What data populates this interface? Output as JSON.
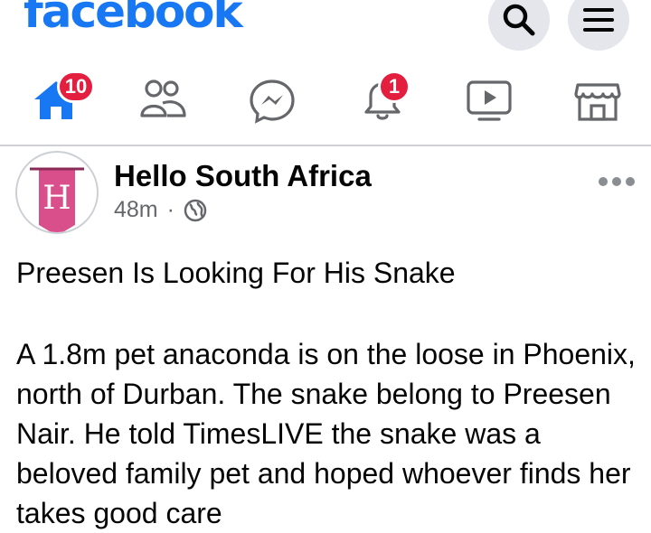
{
  "header": {
    "logo_text": "facebook",
    "brand_color": "#1877f2",
    "search_icon": "search-icon",
    "menu_icon": "menu-icon"
  },
  "nav": {
    "items": [
      {
        "icon": "home-icon",
        "badge": "10",
        "active": true
      },
      {
        "icon": "friends-icon",
        "badge": ""
      },
      {
        "icon": "messenger-icon",
        "badge": ""
      },
      {
        "icon": "bell-icon",
        "badge": "1"
      },
      {
        "icon": "watch-icon",
        "badge": ""
      },
      {
        "icon": "marketplace-icon",
        "badge": ""
      }
    ],
    "badge_color": "#e41e3f"
  },
  "post": {
    "page_name": "Hello South Africa",
    "avatar_letter": "H",
    "time": "48m",
    "separator": "·",
    "audience_icon": "globe-icon",
    "title": "Preesen Is Looking For His Snake",
    "body": "A 1.8m pet anaconda is on the loose in Phoenix, north of Durban. The snake belong to Preesen Nair. He told TimesLIVE the snake was a beloved family pet and hoped whoever finds her takes good care"
  }
}
